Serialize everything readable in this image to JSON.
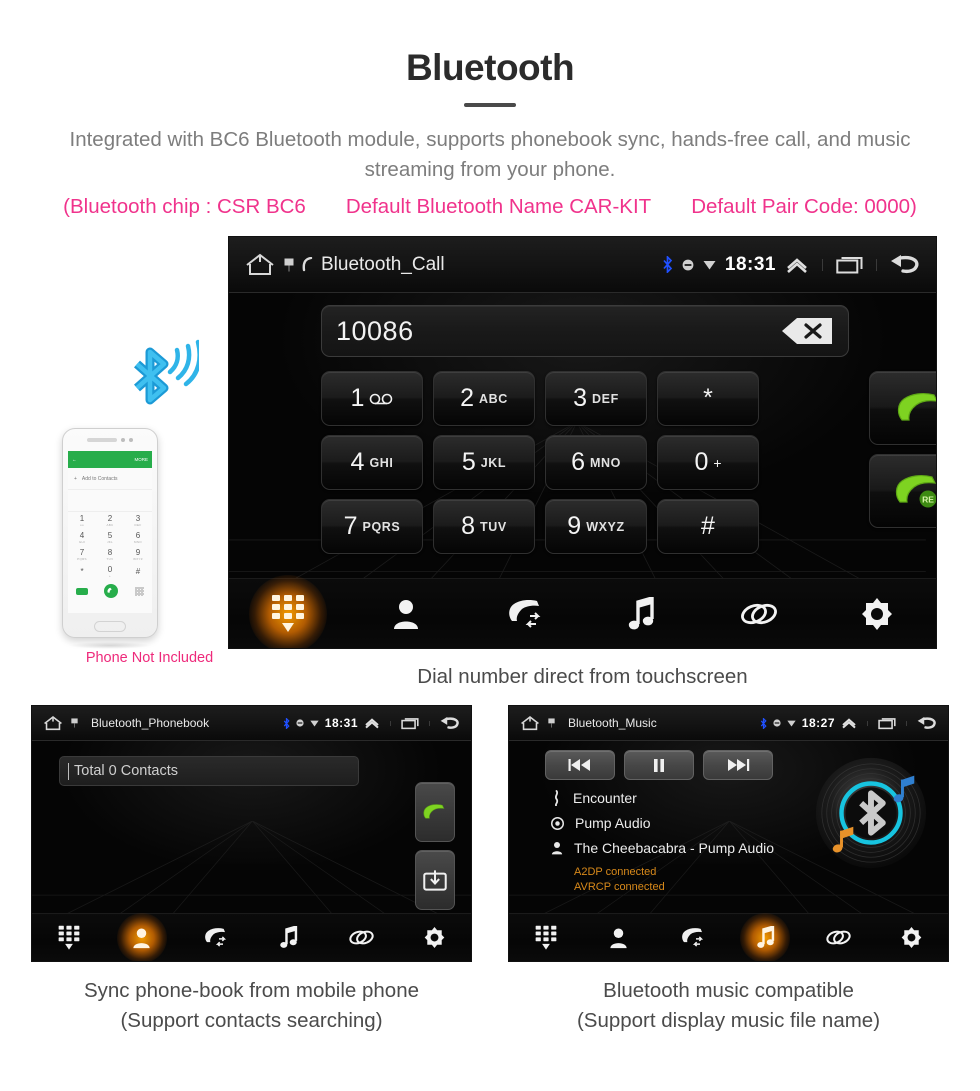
{
  "header": {
    "title": "Bluetooth",
    "subtitle": "Integrated with BC6 Bluetooth module, supports phonebook sync, hands-free call, and music streaming from your phone.",
    "specs": [
      "(Bluetooth chip : CSR BC6",
      "Default Bluetooth Name CAR-KIT",
      "Default Pair Code: 0000)"
    ],
    "accent_color": "#f0338c",
    "title_color": "#2b2b2b",
    "subtitle_color": "#7d7d7d"
  },
  "main_screen": {
    "statusbar": {
      "title": "Bluetooth_Call",
      "clock": "18:31",
      "icons": [
        "home-icon",
        "sim-icon",
        "phone-small-icon",
        "bluetooth-status-icon",
        "mute-icon",
        "wifi-icon",
        "chevron-up-icon",
        "recents-icon",
        "back-icon"
      ]
    },
    "number_field": {
      "value": "10086",
      "backspace_label": "backspace-icon"
    },
    "keys": [
      {
        "digit": "1",
        "letters": "",
        "glyph": "voicemail"
      },
      {
        "digit": "2",
        "letters": "ABC",
        "glyph": ""
      },
      {
        "digit": "3",
        "letters": "DEF",
        "glyph": ""
      },
      {
        "digit": "*",
        "letters": "",
        "glyph": ""
      },
      {
        "digit": "4",
        "letters": "GHI",
        "glyph": ""
      },
      {
        "digit": "5",
        "letters": "JKL",
        "glyph": ""
      },
      {
        "digit": "6",
        "letters": "MNO",
        "glyph": ""
      },
      {
        "digit": "0",
        "letters": "+",
        "glyph": ""
      },
      {
        "digit": "7",
        "letters": "PQRS",
        "glyph": ""
      },
      {
        "digit": "8",
        "letters": "TUV",
        "glyph": ""
      },
      {
        "digit": "9",
        "letters": "WXYZ",
        "glyph": ""
      },
      {
        "digit": "#",
        "letters": "",
        "glyph": ""
      }
    ],
    "call_buttons": [
      {
        "name": "dial-call-button",
        "badge": ""
      },
      {
        "name": "redial-call-button",
        "badge": "RE"
      }
    ],
    "nav": [
      {
        "name": "dialpad",
        "icon": "dialpad-icon",
        "active": true
      },
      {
        "name": "contacts",
        "icon": "contact-icon",
        "active": false
      },
      {
        "name": "call-log",
        "icon": "call-log-icon",
        "active": false
      },
      {
        "name": "music",
        "icon": "music-note-icon",
        "active": false
      },
      {
        "name": "link",
        "icon": "link-icon",
        "active": false
      },
      {
        "name": "settings",
        "icon": "gear-icon",
        "active": false
      }
    ],
    "caption": "Dial number direct from touchscreen"
  },
  "phone_mock": {
    "app_bar_more": "MORE",
    "add_to_contacts": "Add to Contacts",
    "keys": [
      {
        "d": "1",
        "s": "oo"
      },
      {
        "d": "2",
        "s": "ABC"
      },
      {
        "d": "3",
        "s": "DEF"
      },
      {
        "d": "4",
        "s": "GHI"
      },
      {
        "d": "5",
        "s": "JKL"
      },
      {
        "d": "6",
        "s": "MNO"
      },
      {
        "d": "7",
        "s": "PQRS"
      },
      {
        "d": "8",
        "s": "TUV"
      },
      {
        "d": "9",
        "s": "WXYZ"
      },
      {
        "d": "*",
        "s": ""
      },
      {
        "d": "0",
        "s": "+"
      },
      {
        "d": "#",
        "s": ""
      }
    ],
    "not_included_label": "Phone Not Included",
    "not_included_color": "#ee2a7b",
    "bluetooth_icon_color": "#23a8e0"
  },
  "phonebook_screen": {
    "statusbar": {
      "title": "Bluetooth_Phonebook",
      "clock": "18:31"
    },
    "search_value": "Total 0 Contacts",
    "side_buttons": [
      {
        "name": "call-button",
        "icon": "green-handset-icon"
      },
      {
        "name": "download-contacts-button",
        "icon": "download-tray-icon"
      }
    ],
    "nav": [
      {
        "name": "dialpad",
        "icon": "dialpad-icon",
        "active": false
      },
      {
        "name": "contacts",
        "icon": "contact-icon",
        "active": true
      },
      {
        "name": "call-log",
        "icon": "call-log-icon",
        "active": false
      },
      {
        "name": "music",
        "icon": "music-note-icon",
        "active": false
      },
      {
        "name": "link",
        "icon": "link-icon",
        "active": false
      },
      {
        "name": "settings",
        "icon": "gear-icon",
        "active": false
      }
    ],
    "caption_line1": "Sync phone-book from mobile phone",
    "caption_line2": "(Support contacts searching)"
  },
  "music_screen": {
    "statusbar": {
      "title": "Bluetooth_Music",
      "clock": "18:27"
    },
    "transport": [
      {
        "name": "previous-track-button",
        "icon": "skip-back-icon"
      },
      {
        "name": "pause-button",
        "icon": "pause-icon"
      },
      {
        "name": "next-track-button",
        "icon": "skip-forward-icon"
      }
    ],
    "track": {
      "title": "Encounter",
      "album": "Pump Audio",
      "artist": "The Cheebacabra - Pump Audio"
    },
    "status_lines": [
      "A2DP connected",
      "AVRCP connected"
    ],
    "status_color": "#d8891a",
    "nav": [
      {
        "name": "dialpad",
        "icon": "dialpad-icon",
        "active": false
      },
      {
        "name": "contacts",
        "icon": "contact-icon",
        "active": false
      },
      {
        "name": "call-log",
        "icon": "call-log-icon",
        "active": false
      },
      {
        "name": "music",
        "icon": "music-note-icon",
        "active": true
      },
      {
        "name": "link",
        "icon": "link-icon",
        "active": false
      },
      {
        "name": "settings",
        "icon": "gear-icon",
        "active": false
      }
    ],
    "caption_line1": "Bluetooth music compatible",
    "caption_line2": "(Support display music file name)"
  }
}
